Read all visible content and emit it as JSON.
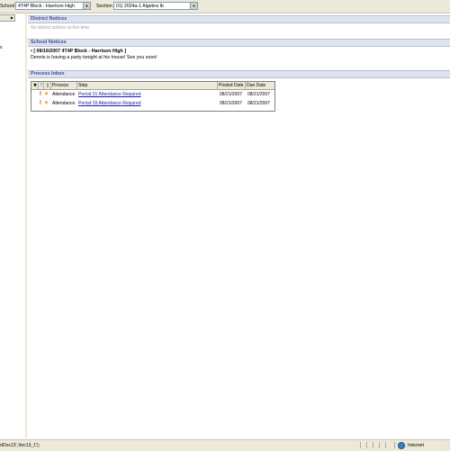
{
  "top": {
    "school_label": "School",
    "school_value": "4T4P Block - Harrison High",
    "section_label": "Section",
    "section_value": "01) 2024a-1 Algebra Ib"
  },
  "left": {
    "item_label": "s"
  },
  "district": {
    "title": "District Notices",
    "empty": "No district notices at this time."
  },
  "school": {
    "title": "School Notices",
    "notice_title": "• [ 08/16/2007 4T4P Block - Harrison High ]",
    "notice_body": "Dennis is having a party tonight at his house! See you soon!"
  },
  "inbox": {
    "title": "Process Inbox",
    "columns": [
      "Process",
      "Step",
      "Posted Date",
      "Due Date"
    ],
    "rows": [
      {
        "process": "Attendance",
        "step": "Period 01 Attendance Required",
        "posted": "08/21/2007",
        "due": "08/21/2007"
      },
      {
        "process": "Attendance",
        "step": "Period 03 Attendance Required",
        "posted": "08/21/2007",
        "due": "08/21/2007"
      }
    ]
  },
  "status": {
    "text": "rtDoc13','doc13_1');",
    "zone": "Internet"
  }
}
